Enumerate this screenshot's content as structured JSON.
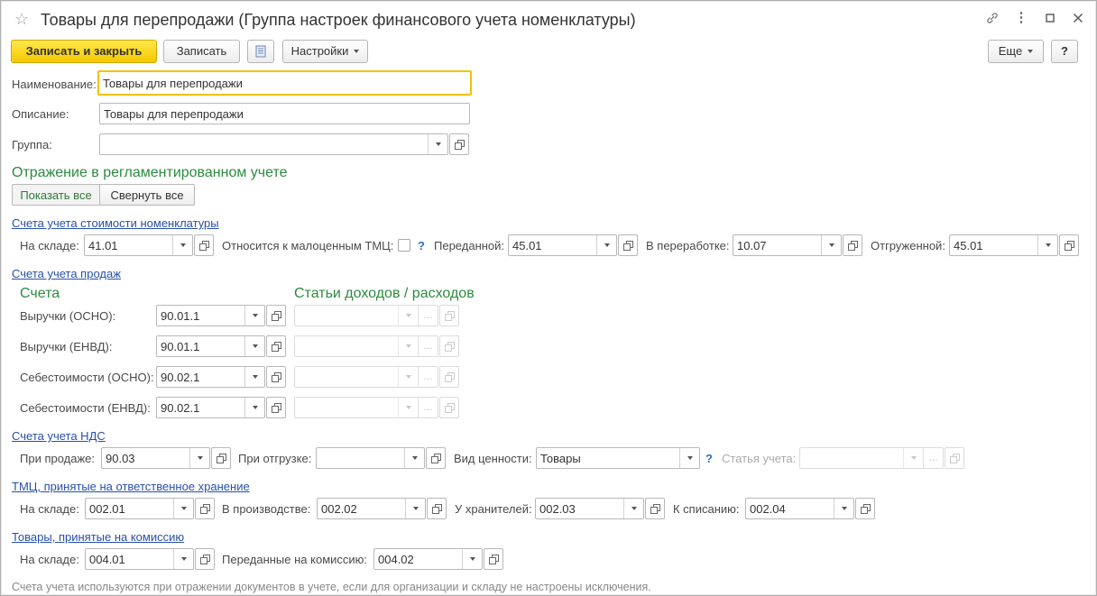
{
  "window": {
    "title": "Товары для перепродажи (Группа настроек финансового учета номенклатуры)"
  },
  "toolbar": {
    "save_close": "Записать и закрыть",
    "save": "Записать",
    "settings": "Настройки",
    "more": "Еще",
    "help": "?"
  },
  "form": {
    "name_label": "Наименование:",
    "name_value": "Товары для перепродажи",
    "desc_label": "Описание:",
    "desc_value": "Товары для перепродажи",
    "group_label": "Группа:",
    "group_value": ""
  },
  "reg": {
    "title": "Отражение в регламентированном учете",
    "show_all": "Показать все",
    "collapse_all": "Свернуть все"
  },
  "cost": {
    "title": "Счета учета стоимости номенклатуры",
    "warehouse_label": "На складе:",
    "warehouse_value": "41.01",
    "low_value_label": "Относится к малоценным ТМЦ:",
    "low_value_checked": false,
    "transferred_label": "Переданной:",
    "transferred_value": "45.01",
    "processing_label": "В переработке:",
    "processing_value": "10.07",
    "shipped_label": "Отгруженной:",
    "shipped_value": "45.01"
  },
  "sales": {
    "title": "Счета учета продаж",
    "col_accounts": "Счета",
    "col_items": "Статьи доходов / расходов",
    "rows": [
      {
        "label": "Выручки (ОСНО):",
        "value": "90.01.1"
      },
      {
        "label": "Выручки (ЕНВД):",
        "value": "90.01.1"
      },
      {
        "label": "Себестоимости (ОСНО):",
        "value": "90.02.1"
      },
      {
        "label": "Себестоимости (ЕНВД):",
        "value": "90.02.1"
      }
    ]
  },
  "vat": {
    "title": "Счета учета НДС",
    "sale_label": "При продаже:",
    "sale_value": "90.03",
    "shipment_label": "При отгрузке:",
    "shipment_value": "",
    "value_type_label": "Вид ценности:",
    "value_type_value": "Товары",
    "item_label": "Статья учета:"
  },
  "custody": {
    "title": "ТМЦ, принятые на ответственное хранение",
    "warehouse_label": "На складе:",
    "warehouse_value": "002.01",
    "production_label": "В производстве:",
    "production_value": "002.02",
    "keepers_label": "У хранителей:",
    "keepers_value": "002.03",
    "writeoff_label": "К списанию:",
    "writeoff_value": "002.04"
  },
  "commission": {
    "title": "Товары, принятые на комиссию",
    "warehouse_label": "На складе:",
    "warehouse_value": "004.01",
    "transferred_label": "Переданные на комиссию:",
    "transferred_value": "004.02"
  },
  "footer": {
    "note": "Счета учета используются при отражении документов в учете, если для организации и складу не настроены исключения."
  }
}
